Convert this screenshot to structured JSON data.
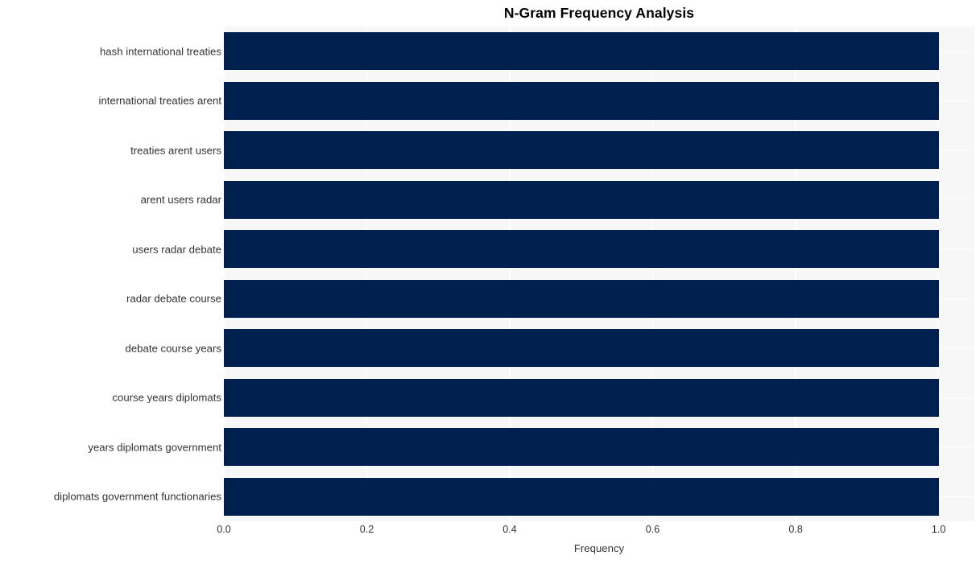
{
  "chart_data": {
    "type": "bar",
    "orientation": "horizontal",
    "title": "N-Gram Frequency Analysis",
    "xlabel": "Frequency",
    "ylabel": "",
    "categories": [
      "hash international treaties",
      "international treaties arent",
      "treaties arent users",
      "arent users radar",
      "users radar debate",
      "radar debate course",
      "debate course years",
      "course years diplomats",
      "years diplomats government",
      "diplomats government functionaries"
    ],
    "values": [
      1.0,
      1.0,
      1.0,
      1.0,
      1.0,
      1.0,
      1.0,
      1.0,
      1.0,
      1.0
    ],
    "xlim": [
      0.0,
      1.05
    ],
    "xticks": [
      0.0,
      0.2,
      0.4,
      0.6,
      0.8,
      1.0
    ],
    "xtick_labels": [
      "0.0",
      "0.2",
      "0.4",
      "0.6",
      "0.8",
      "1.0"
    ],
    "grid": true,
    "legend": null,
    "bar_color": "#002050",
    "plot_background": "#f7f7f7",
    "gridline_color": "#ffffff",
    "figure_background": "#ffffff",
    "text_color": "#333333",
    "title_color": "#000000"
  }
}
